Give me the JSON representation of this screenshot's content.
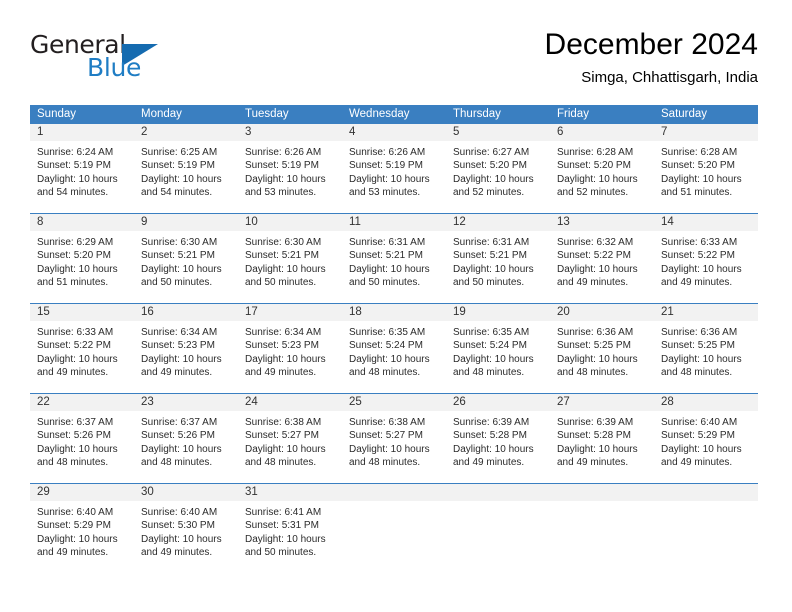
{
  "brand": {
    "name_part1": "General",
    "name_part2": "Blue"
  },
  "header": {
    "title": "December 2024",
    "subtitle": "Simga, Chhattisgarh, India"
  },
  "colors": {
    "header_blue": "#3a7fc1",
    "logo_blue": "#1f7dc4",
    "day_strip": "#f2f2f2"
  },
  "weekdays": [
    "Sunday",
    "Monday",
    "Tuesday",
    "Wednesday",
    "Thursday",
    "Friday",
    "Saturday"
  ],
  "weeks": [
    [
      {
        "day": "1",
        "sunrise": "Sunrise: 6:24 AM",
        "sunset": "Sunset: 5:19 PM",
        "daylight1": "Daylight: 10 hours",
        "daylight2": "and 54 minutes."
      },
      {
        "day": "2",
        "sunrise": "Sunrise: 6:25 AM",
        "sunset": "Sunset: 5:19 PM",
        "daylight1": "Daylight: 10 hours",
        "daylight2": "and 54 minutes."
      },
      {
        "day": "3",
        "sunrise": "Sunrise: 6:26 AM",
        "sunset": "Sunset: 5:19 PM",
        "daylight1": "Daylight: 10 hours",
        "daylight2": "and 53 minutes."
      },
      {
        "day": "4",
        "sunrise": "Sunrise: 6:26 AM",
        "sunset": "Sunset: 5:19 PM",
        "daylight1": "Daylight: 10 hours",
        "daylight2": "and 53 minutes."
      },
      {
        "day": "5",
        "sunrise": "Sunrise: 6:27 AM",
        "sunset": "Sunset: 5:20 PM",
        "daylight1": "Daylight: 10 hours",
        "daylight2": "and 52 minutes."
      },
      {
        "day": "6",
        "sunrise": "Sunrise: 6:28 AM",
        "sunset": "Sunset: 5:20 PM",
        "daylight1": "Daylight: 10 hours",
        "daylight2": "and 52 minutes."
      },
      {
        "day": "7",
        "sunrise": "Sunrise: 6:28 AM",
        "sunset": "Sunset: 5:20 PM",
        "daylight1": "Daylight: 10 hours",
        "daylight2": "and 51 minutes."
      }
    ],
    [
      {
        "day": "8",
        "sunrise": "Sunrise: 6:29 AM",
        "sunset": "Sunset: 5:20 PM",
        "daylight1": "Daylight: 10 hours",
        "daylight2": "and 51 minutes."
      },
      {
        "day": "9",
        "sunrise": "Sunrise: 6:30 AM",
        "sunset": "Sunset: 5:21 PM",
        "daylight1": "Daylight: 10 hours",
        "daylight2": "and 50 minutes."
      },
      {
        "day": "10",
        "sunrise": "Sunrise: 6:30 AM",
        "sunset": "Sunset: 5:21 PM",
        "daylight1": "Daylight: 10 hours",
        "daylight2": "and 50 minutes."
      },
      {
        "day": "11",
        "sunrise": "Sunrise: 6:31 AM",
        "sunset": "Sunset: 5:21 PM",
        "daylight1": "Daylight: 10 hours",
        "daylight2": "and 50 minutes."
      },
      {
        "day": "12",
        "sunrise": "Sunrise: 6:31 AM",
        "sunset": "Sunset: 5:21 PM",
        "daylight1": "Daylight: 10 hours",
        "daylight2": "and 50 minutes."
      },
      {
        "day": "13",
        "sunrise": "Sunrise: 6:32 AM",
        "sunset": "Sunset: 5:22 PM",
        "daylight1": "Daylight: 10 hours",
        "daylight2": "and 49 minutes."
      },
      {
        "day": "14",
        "sunrise": "Sunrise: 6:33 AM",
        "sunset": "Sunset: 5:22 PM",
        "daylight1": "Daylight: 10 hours",
        "daylight2": "and 49 minutes."
      }
    ],
    [
      {
        "day": "15",
        "sunrise": "Sunrise: 6:33 AM",
        "sunset": "Sunset: 5:22 PM",
        "daylight1": "Daylight: 10 hours",
        "daylight2": "and 49 minutes."
      },
      {
        "day": "16",
        "sunrise": "Sunrise: 6:34 AM",
        "sunset": "Sunset: 5:23 PM",
        "daylight1": "Daylight: 10 hours",
        "daylight2": "and 49 minutes."
      },
      {
        "day": "17",
        "sunrise": "Sunrise: 6:34 AM",
        "sunset": "Sunset: 5:23 PM",
        "daylight1": "Daylight: 10 hours",
        "daylight2": "and 49 minutes."
      },
      {
        "day": "18",
        "sunrise": "Sunrise: 6:35 AM",
        "sunset": "Sunset: 5:24 PM",
        "daylight1": "Daylight: 10 hours",
        "daylight2": "and 48 minutes."
      },
      {
        "day": "19",
        "sunrise": "Sunrise: 6:35 AM",
        "sunset": "Sunset: 5:24 PM",
        "daylight1": "Daylight: 10 hours",
        "daylight2": "and 48 minutes."
      },
      {
        "day": "20",
        "sunrise": "Sunrise: 6:36 AM",
        "sunset": "Sunset: 5:25 PM",
        "daylight1": "Daylight: 10 hours",
        "daylight2": "and 48 minutes."
      },
      {
        "day": "21",
        "sunrise": "Sunrise: 6:36 AM",
        "sunset": "Sunset: 5:25 PM",
        "daylight1": "Daylight: 10 hours",
        "daylight2": "and 48 minutes."
      }
    ],
    [
      {
        "day": "22",
        "sunrise": "Sunrise: 6:37 AM",
        "sunset": "Sunset: 5:26 PM",
        "daylight1": "Daylight: 10 hours",
        "daylight2": "and 48 minutes."
      },
      {
        "day": "23",
        "sunrise": "Sunrise: 6:37 AM",
        "sunset": "Sunset: 5:26 PM",
        "daylight1": "Daylight: 10 hours",
        "daylight2": "and 48 minutes."
      },
      {
        "day": "24",
        "sunrise": "Sunrise: 6:38 AM",
        "sunset": "Sunset: 5:27 PM",
        "daylight1": "Daylight: 10 hours",
        "daylight2": "and 48 minutes."
      },
      {
        "day": "25",
        "sunrise": "Sunrise: 6:38 AM",
        "sunset": "Sunset: 5:27 PM",
        "daylight1": "Daylight: 10 hours",
        "daylight2": "and 48 minutes."
      },
      {
        "day": "26",
        "sunrise": "Sunrise: 6:39 AM",
        "sunset": "Sunset: 5:28 PM",
        "daylight1": "Daylight: 10 hours",
        "daylight2": "and 49 minutes."
      },
      {
        "day": "27",
        "sunrise": "Sunrise: 6:39 AM",
        "sunset": "Sunset: 5:28 PM",
        "daylight1": "Daylight: 10 hours",
        "daylight2": "and 49 minutes."
      },
      {
        "day": "28",
        "sunrise": "Sunrise: 6:40 AM",
        "sunset": "Sunset: 5:29 PM",
        "daylight1": "Daylight: 10 hours",
        "daylight2": "and 49 minutes."
      }
    ],
    [
      {
        "day": "29",
        "sunrise": "Sunrise: 6:40 AM",
        "sunset": "Sunset: 5:29 PM",
        "daylight1": "Daylight: 10 hours",
        "daylight2": "and 49 minutes."
      },
      {
        "day": "30",
        "sunrise": "Sunrise: 6:40 AM",
        "sunset": "Sunset: 5:30 PM",
        "daylight1": "Daylight: 10 hours",
        "daylight2": "and 49 minutes."
      },
      {
        "day": "31",
        "sunrise": "Sunrise: 6:41 AM",
        "sunset": "Sunset: 5:31 PM",
        "daylight1": "Daylight: 10 hours",
        "daylight2": "and 50 minutes."
      },
      {
        "day": "",
        "sunrise": "",
        "sunset": "",
        "daylight1": "",
        "daylight2": ""
      },
      {
        "day": "",
        "sunrise": "",
        "sunset": "",
        "daylight1": "",
        "daylight2": ""
      },
      {
        "day": "",
        "sunrise": "",
        "sunset": "",
        "daylight1": "",
        "daylight2": ""
      },
      {
        "day": "",
        "sunrise": "",
        "sunset": "",
        "daylight1": "",
        "daylight2": ""
      }
    ]
  ]
}
